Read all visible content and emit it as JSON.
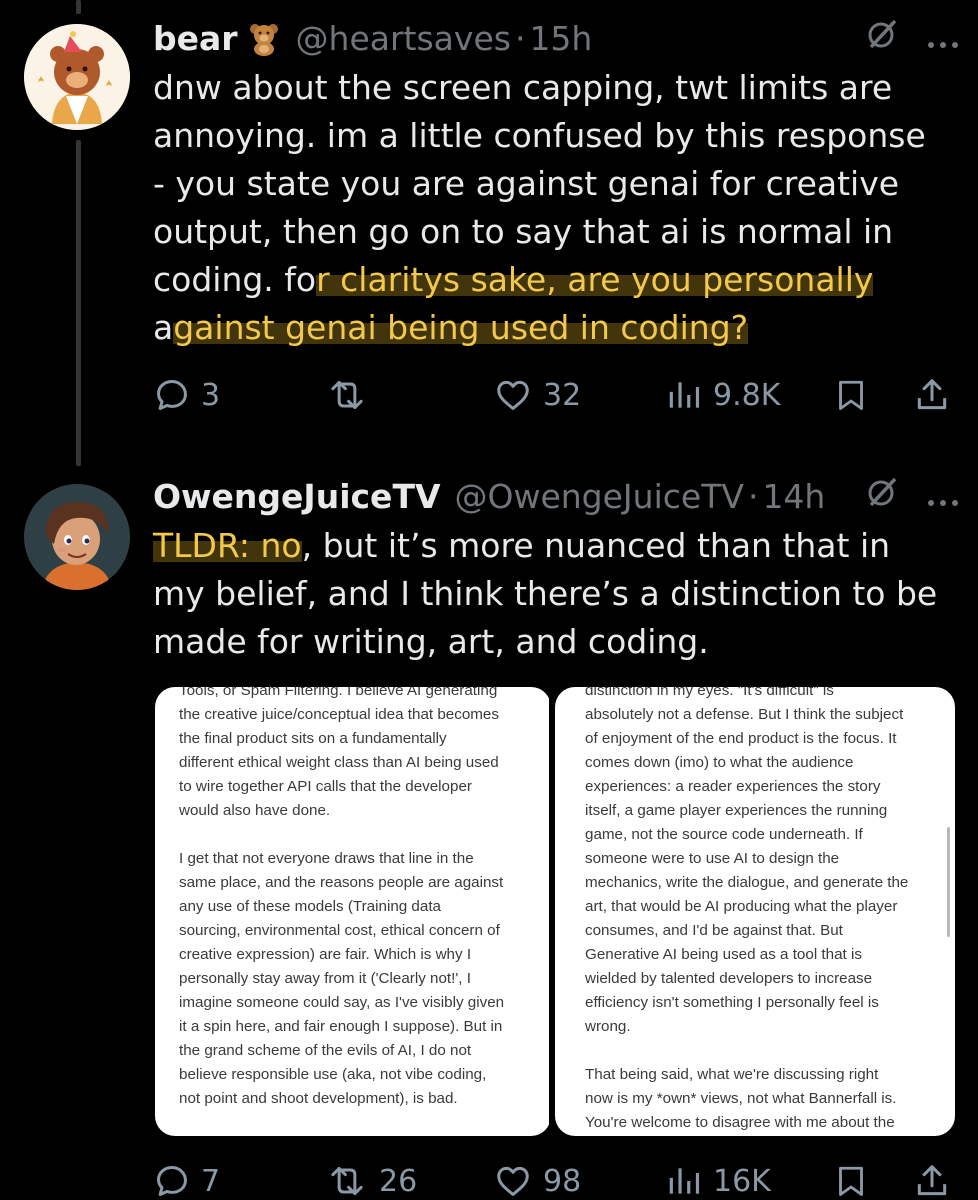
{
  "tweets": [
    {
      "name": "bear",
      "handle": "@heartsaves",
      "time": "15h",
      "text_plain": "dnw about the screen capping, twt limits are annoying. im a little confused by this response - you state you are against genai for creative output, then go on to say that ai is normal in coding. fo",
      "text_highlight": "r claritys sake, are you personally against genai being used in coding?",
      "lines": [
        "dnw about the screen capping, twt limits are",
        "annoying. im a little confused by this response",
        "- you state you are against genai for creative",
        "output, then go on to say that ai is normal in"
      ],
      "line5_plain": "coding. fo",
      "line5_hl": "r claritys sake, are you personally",
      "line6_plain": "a",
      "line6_hl": "gainst genai being used in coding?",
      "replies": "3",
      "reposts": "",
      "likes": "32",
      "views": "9.8K"
    },
    {
      "name": "OwengeJuiceTV",
      "handle": "@OwengeJuiceTV",
      "time": "14h",
      "line1_hl": "TLDR: no",
      "line1_plain": ", but it’s more nuanced than that in",
      "line2": "my belief, and I think there’s a distinction to be",
      "line3": "made for writing, art, and coding.",
      "replies": "7",
      "reposts": "26",
      "likes": "98",
      "views": "16K"
    }
  ],
  "card_left": {
    "lines_a": [
      "Tools, or Spam Filtering. I believe AI generating",
      "the creative juice/conceptual idea that becomes",
      "the final product sits on a fundamentally",
      "different ethical weight class than AI being used",
      "to wire together API calls that the developer",
      "would also have done."
    ],
    "lines_b": [
      "I get that not everyone draws that line in the",
      "same place, and the reasons people are against",
      "any use of these models (Training data",
      "sourcing, environmental cost, ethical concern of",
      "creative expression) are fair. Which is why I",
      "personally stay away from it ('Clearly not!', I",
      "imagine someone could say, as I've visibly given",
      "it a spin here, and fair enough I suppose). But in",
      "the grand scheme of the evils of AI, I do not",
      "believe responsible use (aka, not vibe coding,",
      "not point and shoot development), is bad."
    ]
  },
  "card_right": {
    "lines_a": [
      "distinction in my eyes. \"It's difficult\" is",
      "absolutely not a defense. But I think the subject",
      "of enjoyment of the end product is the focus. It",
      "comes down (imo) to what the audience",
      "experiences: a reader experiences the story",
      "itself, a game player experiences the running",
      "game, not the source code underneath. If",
      "someone were to use AI to design the",
      "mechanics, write the dialogue, and generate the",
      "art, that would be AI producing what the player",
      "consumes, and I'd be against that. But",
      "Generative AI being used as a tool that is",
      "wielded by talented developers to increase",
      "efficiency isn't something I personally feel is",
      "wrong."
    ],
    "lines_b": [
      "That being said, what we're discussing right",
      "now is my *own* views, not what Bannerfall is.",
      "You're welcome to disagree with me about the"
    ]
  },
  "icons": {
    "emoji": "teddy-bear",
    "grok": "grok-icon",
    "more": "more-icon",
    "reply": "reply-icon",
    "repost": "repost-icon",
    "like": "heart-icon",
    "views": "views-icon",
    "bookmark": "bookmark-icon",
    "share": "share-icon"
  },
  "colors": {
    "background": "#000000",
    "text": "#e7e9ea",
    "muted": "#71767b",
    "highlight_text": "#f2c94c"
  }
}
